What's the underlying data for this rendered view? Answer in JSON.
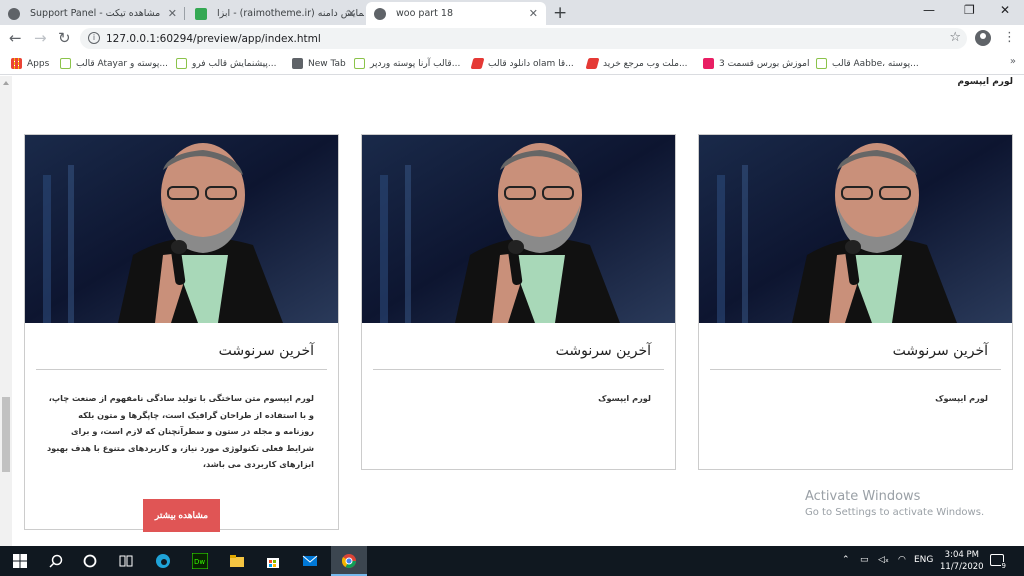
{
  "browser": {
    "tabs": [
      {
        "title": "Support Panel - مشاهده تیکت",
        "active": false
      },
      {
        "title": "ابزا - (raimotheme.ir) نمایش دامنه",
        "active": false
      },
      {
        "title": "woo part 18",
        "active": true
      }
    ],
    "url": "127.0.0.1:60294/preview/app/index.html",
    "bookmarks": [
      "Apps",
      "قالب Atayar پوسته و...",
      "پیشنمایش قالب فرو...",
      "New Tab",
      "قالب آرنا پوسته وردپر...",
      "دانلود قالب olam قا...",
      "ملت وب مرجع خرید...",
      "اموزش بورس قسمت 3",
      "قالب Aabbe، پوسته..."
    ],
    "bookmarks_more": "»"
  },
  "page": {
    "top_text": "لورم ایپسوم",
    "cards": [
      {
        "title": "آخرین سرنوشت",
        "body": "لورم ایپسوک",
        "has_button": false
      },
      {
        "title": "آخرین سرنوشت",
        "body": "لورم ایپسوک",
        "has_button": false
      },
      {
        "title": "آخرین سرنوشت",
        "body": "لورم ایپسوم متن ساختگی با تولید سادگی نامفهوم از صنعت چاپ، و با استفاده از طراحان گرافیک است، چاپگرها و متون بلکه روزنامه و مجله در ستون و سطرآنچنان که لازم است، و برای شرایط فعلی تکنولوژی مورد نیاز، و کاربردهای متنوع با هدف بهبود ابزارهای کاربردی می باشد،",
        "has_button": true,
        "button": "مشاهده بیشتر"
      }
    ],
    "watermark": {
      "line1": "Activate Windows",
      "line2": "Go to Settings to activate Windows."
    }
  },
  "taskbar": {
    "language": "ENG",
    "time": "3:04 PM",
    "date": "11/7/2020",
    "notification_count": "9"
  },
  "colors": {
    "button": "#e05555",
    "taskbar": "#101820",
    "tabstrip": "#dee1e6"
  }
}
